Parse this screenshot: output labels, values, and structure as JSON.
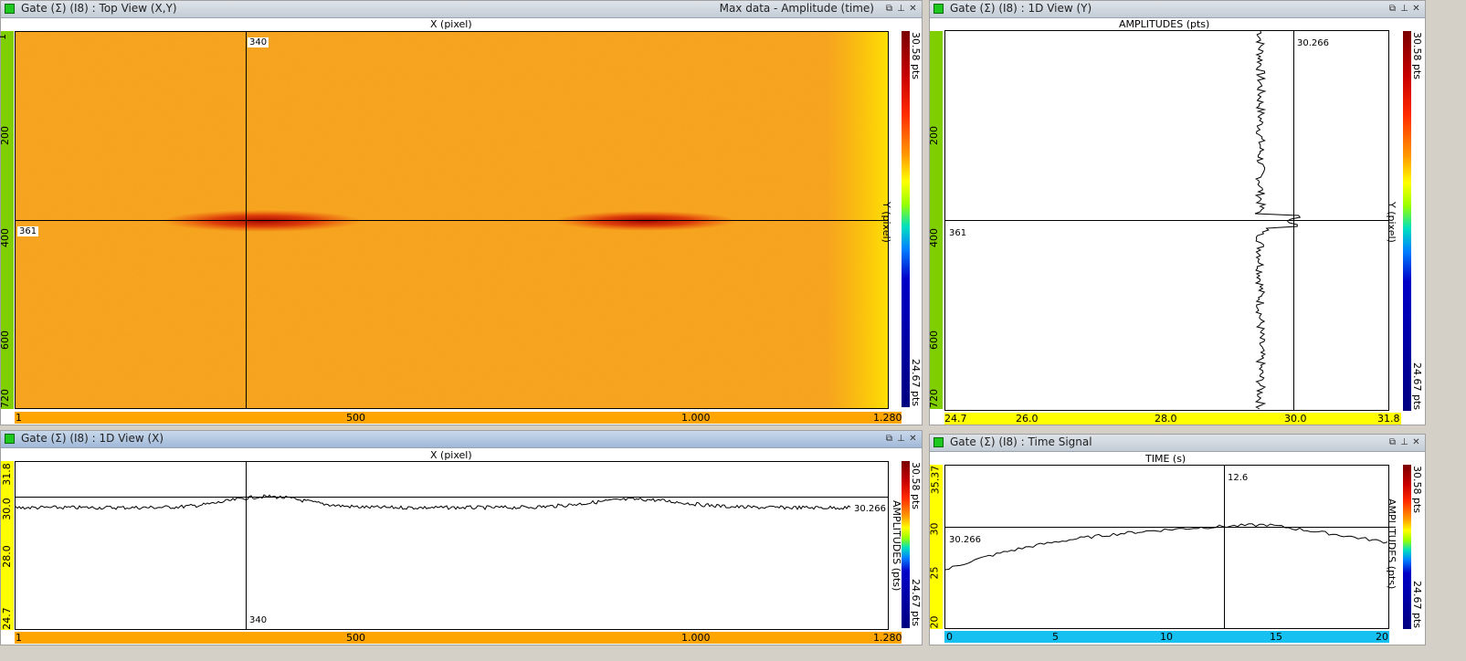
{
  "topview": {
    "title": "Gate (Σ) (I8) : Top View (X,Y)",
    "info": "Max data - Amplitude (time)",
    "xlabel": "X (pixel)",
    "ylabel": "Y (pixel)",
    "y_ticks": [
      "200",
      "400",
      "600",
      "720"
    ],
    "y_top": "1",
    "x_ticks": [
      "1",
      "500",
      "1.000",
      "1.280"
    ],
    "cursor_x": "340",
    "cursor_y": "361",
    "scale_max": "30.58 pts",
    "scale_min": "24.67 pts"
  },
  "view_y": {
    "title": "Gate (Σ) (I8) : 1D View (Y)",
    "xlabel": "AMPLITUDES (pts)",
    "ylabel": "Y (pixel)",
    "y_ticks": [
      "200",
      "400",
      "600",
      "720"
    ],
    "x_ticks": [
      "24.7",
      "26.0",
      "28.0",
      "30.0",
      "31.8"
    ],
    "cursor_value": "30.266",
    "cursor_y": "361",
    "scale_max": "30.58 pts",
    "scale_min": "24.67 pts"
  },
  "view_x": {
    "title": "Gate (Σ) (I8) : 1D View (X)",
    "xlabel": "X (pixel)",
    "ylabel": "AMPLITUDES (pts)",
    "y_ticks": [
      "31.8",
      "30.0",
      "28.0",
      "24.7"
    ],
    "x_ticks": [
      "1",
      "500",
      "1.000",
      "1.280"
    ],
    "cursor_x": "340",
    "cursor_value": "30.266",
    "scale_max": "30.58 pts",
    "scale_min": "24.67 pts"
  },
  "time_signal": {
    "title": "Gate (Σ) (I8) : Time Signal",
    "xlabel": "TIME (s)",
    "ylabel": "AMPLITUDES (pts)",
    "y_ticks": [
      "35.37",
      "30",
      "25",
      "20"
    ],
    "x_ticks": [
      "0",
      "5",
      "10",
      "15",
      "20"
    ],
    "cursor_time": "12.6",
    "cursor_value": "30.266",
    "scale_max": "30.58 pts",
    "scale_min": "24.67 pts"
  },
  "window_buttons": {
    "restore": "⧉",
    "pin": "⊥",
    "close": "✕"
  },
  "colors": {
    "accent_green": "#1ec81e",
    "axis_green": "#7fcf00",
    "axis_orange": "#ffa500",
    "axis_yellow": "#ffff00",
    "axis_cyan": "#16c0f0",
    "map_base": "#f5a623",
    "defect_red": "#c40000"
  }
}
